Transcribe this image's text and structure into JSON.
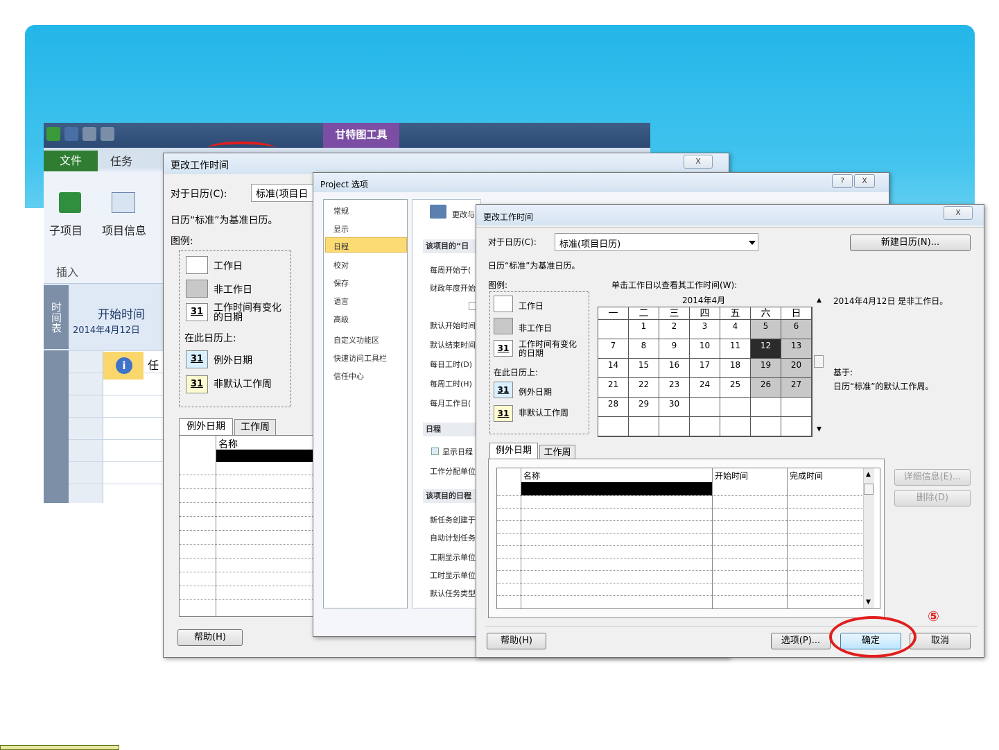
{
  "project_window": {
    "gantt_tools_tab": "甘特图工具",
    "file_tab": "文件",
    "task_tab": "任务",
    "ribbon": {
      "subproject": "子项目",
      "project_info": "项目信息",
      "group_insert": "插入"
    },
    "timeline_label": "时间表",
    "timeline_start": "开始时间",
    "timeline_date": "2014年4月12日",
    "info_icon_glyph": "i",
    "col_task_partial": "任"
  },
  "dialog_back": {
    "title": "更改工作时间",
    "close": "X",
    "for_calendar_label": "对于日历(C):",
    "for_calendar_value": "标准(项目日",
    "base_calendar_text": "日历“标准”为基准日历。",
    "legend_label": "图例:",
    "legend": {
      "working": "工作日",
      "nonworking": "非工作日",
      "edited_number": "31",
      "edited": "工作时间有变化的日期",
      "on_this_calendar": "在此日历上:",
      "exception_number": "31",
      "exception": "例外日期",
      "nondefault_number": "31",
      "nondefault": "非默认工作周"
    },
    "tabs": [
      "例外日期",
      "工作周"
    ],
    "table_header_name": "名称",
    "help_button": "帮助(H)"
  },
  "options_dialog": {
    "title": "Project 选项",
    "help_icon": "?",
    "close": "X",
    "nav": [
      "常规",
      "显示",
      "日程",
      "校对",
      "保存",
      "语言",
      "高级",
      "自定义功能区",
      "快速访问工具栏",
      "信任中心"
    ],
    "right_top_label": "更改与",
    "section_project": "该项目的“日",
    "right_items": [
      "每周开始于(",
      "财政年度开始"
    ],
    "right_items2": [
      "默认开始时间",
      "默认结束时间",
      "每日工时(D)",
      "每周工时(H)",
      "每月工作日("
    ],
    "section_schedule": "日程",
    "check_show": "显示日程",
    "work_unit": "工作分配单位",
    "section_project_schedule": "该项目的日程",
    "right_items3": [
      "新任务创建于",
      "自动计划任务",
      "工期显示单位",
      "工时显示单位",
      "默认任务类型"
    ]
  },
  "dialog_front": {
    "title": "更改工作时间",
    "close": "X",
    "for_calendar_label": "对于日历(C):",
    "for_calendar_value": "标准(项目日历)",
    "new_calendar_button": "新建日历(N)...",
    "base_calendar_text": "日历“标准”为基准日历。",
    "legend_label": "图例:",
    "click_hint": "单击工作日以查看其工作时间(W):",
    "legend": {
      "working": "工作日",
      "nonworking": "非工作日",
      "edited_number": "31",
      "edited": "工作时间有变化的日期",
      "on_this_calendar": "在此日历上:",
      "exception_number": "31",
      "exception": "例外日期",
      "nondefault_number": "31",
      "nondefault": "非默认工作周"
    },
    "calendar": {
      "month": "2014年4月",
      "weekdays": [
        "一",
        "二",
        "三",
        "四",
        "五",
        "六",
        "日"
      ],
      "weeks": [
        [
          "",
          "1",
          "2",
          "3",
          "4",
          "5",
          "6"
        ],
        [
          "7",
          "8",
          "9",
          "10",
          "11",
          "12",
          "13"
        ],
        [
          "14",
          "15",
          "16",
          "17",
          "18",
          "19",
          "20"
        ],
        [
          "21",
          "22",
          "23",
          "24",
          "25",
          "26",
          "27"
        ],
        [
          "28",
          "29",
          "30",
          "",
          "",
          "",
          ""
        ],
        [
          "",
          "",
          "",
          "",
          "",
          "",
          ""
        ]
      ],
      "selected_day": "12"
    },
    "status_text": "2014年4月12日 是非工作日。",
    "based_on_label": "基于:",
    "based_on_text": "日历“标准”的默认工作周。",
    "tabs": [
      "例外日期",
      "工作周"
    ],
    "table_headers": [
      "名称",
      "开始时间",
      "完成时间"
    ],
    "details_button": "详细信息(E)...",
    "delete_button": "删除(D)",
    "help_button": "帮助(H)",
    "options_button": "选项(P)...",
    "ok_button": "确定",
    "cancel_button": "取消",
    "step_marker": "⑤"
  },
  "colors": {
    "banner": "#2bb9e9",
    "highlight_ring": "#e01e1e",
    "nav_selected": "#fcdb74",
    "file_tab": "#2e7d32"
  }
}
